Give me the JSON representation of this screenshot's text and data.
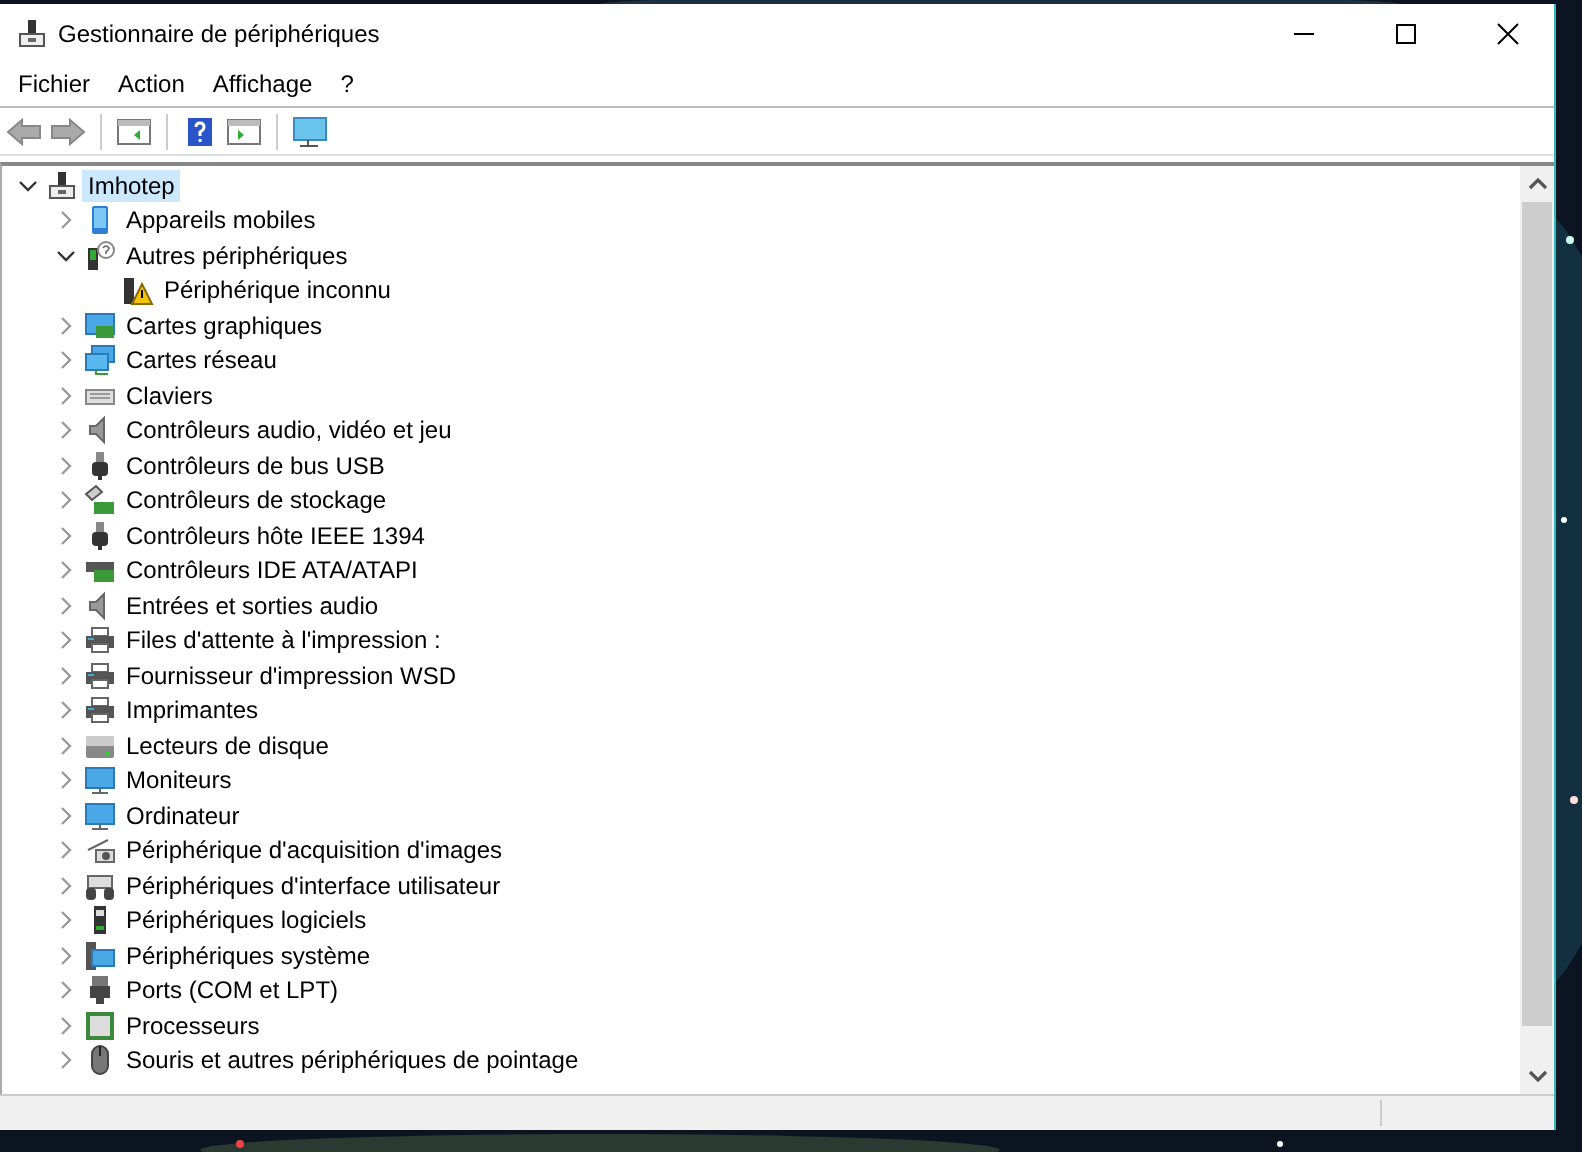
{
  "window": {
    "title": "Gestionnaire de périphériques"
  },
  "menu": [
    "Fichier",
    "Action",
    "Affichage",
    "?"
  ],
  "tree": [
    {
      "label": "Imhotep",
      "kind": "computer-root",
      "selected": true,
      "expanded": true,
      "children": [
        {
          "label": "Appareils mobiles",
          "kind": "phone",
          "selected": false,
          "expanded": false
        },
        {
          "label": "Autres périphériques",
          "kind": "unknown",
          "selected": false,
          "expanded": true,
          "children": [
            {
              "label": "Périphérique inconnu",
              "kind": "warning",
              "selected": false
            }
          ]
        },
        {
          "label": "Cartes graphiques",
          "kind": "display",
          "selected": false,
          "expanded": false
        },
        {
          "label": "Cartes réseau",
          "kind": "network",
          "selected": false,
          "expanded": false
        },
        {
          "label": "Claviers",
          "kind": "keyboard",
          "selected": false,
          "expanded": false
        },
        {
          "label": "Contrôleurs audio, vidéo et jeu",
          "kind": "speaker",
          "selected": false,
          "expanded": false
        },
        {
          "label": "Contrôleurs de bus USB",
          "kind": "usb",
          "selected": false,
          "expanded": false
        },
        {
          "label": "Contrôleurs de stockage",
          "kind": "storage",
          "selected": false,
          "expanded": false
        },
        {
          "label": "Contrôleurs hôte IEEE 1394",
          "kind": "usb",
          "selected": false,
          "expanded": false
        },
        {
          "label": "Contrôleurs IDE ATA/ATAPI",
          "kind": "card",
          "selected": false,
          "expanded": false
        },
        {
          "label": "Entrées et sorties audio",
          "kind": "speaker",
          "selected": false,
          "expanded": false
        },
        {
          "label": "Files d'attente à l'impression :",
          "kind": "printer",
          "selected": false,
          "expanded": false
        },
        {
          "label": "Fournisseur d'impression WSD",
          "kind": "printer",
          "selected": false,
          "expanded": false
        },
        {
          "label": "Imprimantes",
          "kind": "printer",
          "selected": false,
          "expanded": false
        },
        {
          "label": "Lecteurs de disque",
          "kind": "disk",
          "selected": false,
          "expanded": false
        },
        {
          "label": "Moniteurs",
          "kind": "monitor",
          "selected": false,
          "expanded": false
        },
        {
          "label": "Ordinateur",
          "kind": "monitor",
          "selected": false,
          "expanded": false
        },
        {
          "label": "Périphérique d'acquisition d'images",
          "kind": "camera",
          "selected": false,
          "expanded": false
        },
        {
          "label": "Périphériques d'interface utilisateur",
          "kind": "hid",
          "selected": false,
          "expanded": false
        },
        {
          "label": "Périphériques logiciels",
          "kind": "software",
          "selected": false,
          "expanded": false
        },
        {
          "label": "Périphériques système",
          "kind": "system",
          "selected": false,
          "expanded": false
        },
        {
          "label": "Ports (COM et LPT)",
          "kind": "port",
          "selected": false,
          "expanded": false
        },
        {
          "label": "Processeurs",
          "kind": "cpu",
          "selected": false,
          "expanded": false
        },
        {
          "label": "Souris et autres périphériques de pointage",
          "kind": "mouse",
          "selected": false,
          "expanded": false
        }
      ]
    }
  ]
}
